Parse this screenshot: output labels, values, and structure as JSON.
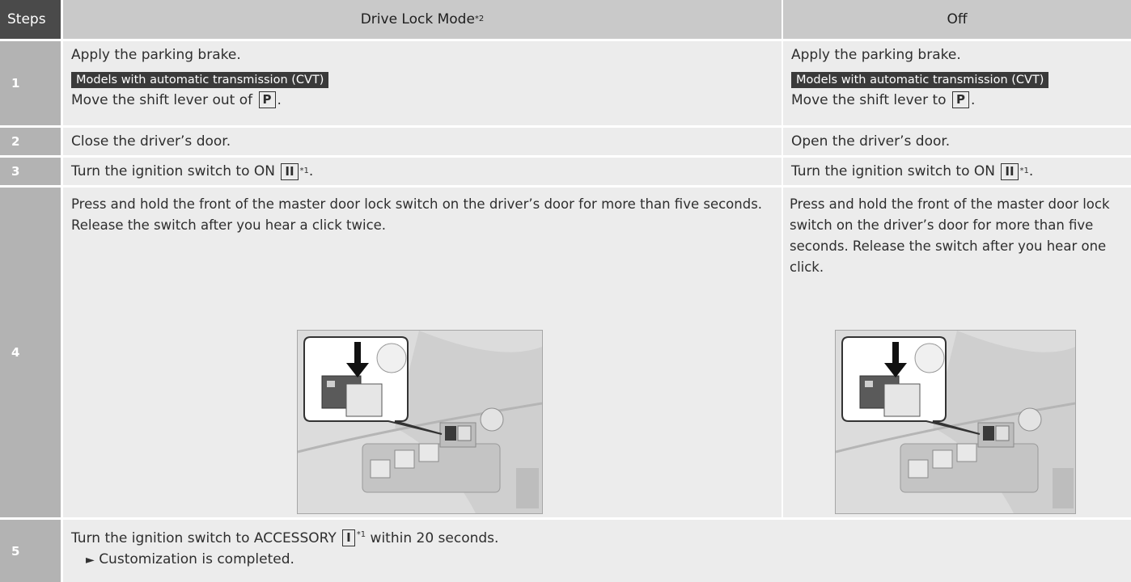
{
  "header": {
    "steps": "Steps",
    "col1": "Drive Lock Mode",
    "col1_sup": "*2",
    "col2": "Off"
  },
  "rows": [
    {
      "num": "1",
      "c1": {
        "line1": "Apply the parking brake.",
        "badge": "Models with automatic transmission (CVT)",
        "line2_pre": "Move the shift lever out of ",
        "key": "P",
        "line2_post": "."
      },
      "c2": {
        "line1": "Apply the parking brake.",
        "badge": "Models with automatic transmission (CVT)",
        "line2_pre": "Move the shift lever to ",
        "key": "P",
        "line2_post": "."
      }
    },
    {
      "num": "2",
      "c1": "Close the driver’s door.",
      "c2": "Open the driver’s door."
    },
    {
      "num": "3",
      "c1": {
        "pre": "Turn the ignition switch to ON ",
        "key": "II",
        "sup": "*1",
        "post": "."
      },
      "c2": {
        "pre": "Turn the ignition switch to ON ",
        "key": "II",
        "sup": "*1",
        "post": "."
      }
    },
    {
      "num": "4",
      "c1": "Press and hold the front of the master door lock switch on the driver’s door for more than five seconds. Release the switch after you hear a click twice.",
      "c2": "Press and hold the front of the master door lock switch on the driver’s door for more than five seconds. Release the switch after you hear one click."
    },
    {
      "num": "5",
      "pre": "Turn the ignition switch to ACCESSORY ",
      "key": "I",
      "sup": "*1",
      "post": " within 20 seconds.",
      "result_icon": "black-right-pointer-icon",
      "result": "Customization is completed."
    }
  ],
  "colors": {
    "header_step": "#4a4a4a",
    "header_cell": "#c9c9c9",
    "step_cell": "#b3b3b3",
    "body_cell": "#ececec",
    "badge": "#3a3a3a"
  }
}
